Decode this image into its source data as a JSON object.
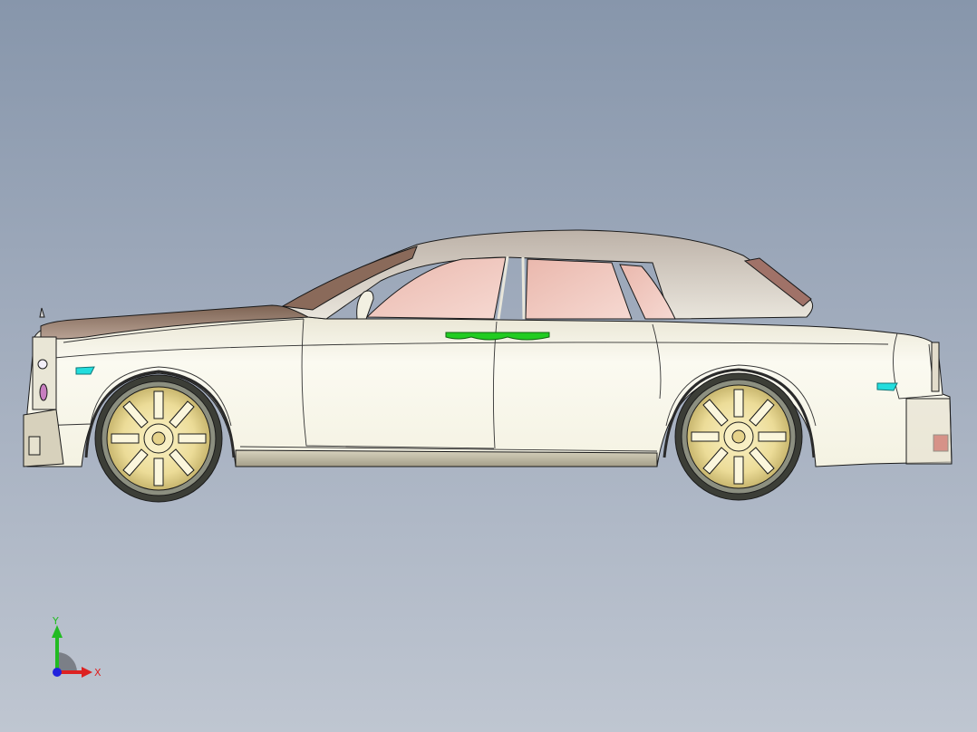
{
  "view": {
    "background_top": "#8796ab",
    "background_bottom": "#bfc6d1"
  },
  "model": {
    "type": "sedan-side-view",
    "body_color": "#f4f2e4",
    "roof_color": "#c9c0b6",
    "glass_color": "#f0c8bf",
    "bonnet_color": "#9b8070",
    "wheel_color": "#eadb96",
    "tire_color": "#3a3c36",
    "trim_green": "#22cc22",
    "lamp_cyan": "#22dddd",
    "tail_red": "#c02020",
    "outline_color": "#1a1a1a"
  },
  "triad": {
    "x_label": "X",
    "y_label": "Y",
    "x_color": "#dd2222",
    "y_color": "#22bb22",
    "z_color": "#2222dd"
  }
}
